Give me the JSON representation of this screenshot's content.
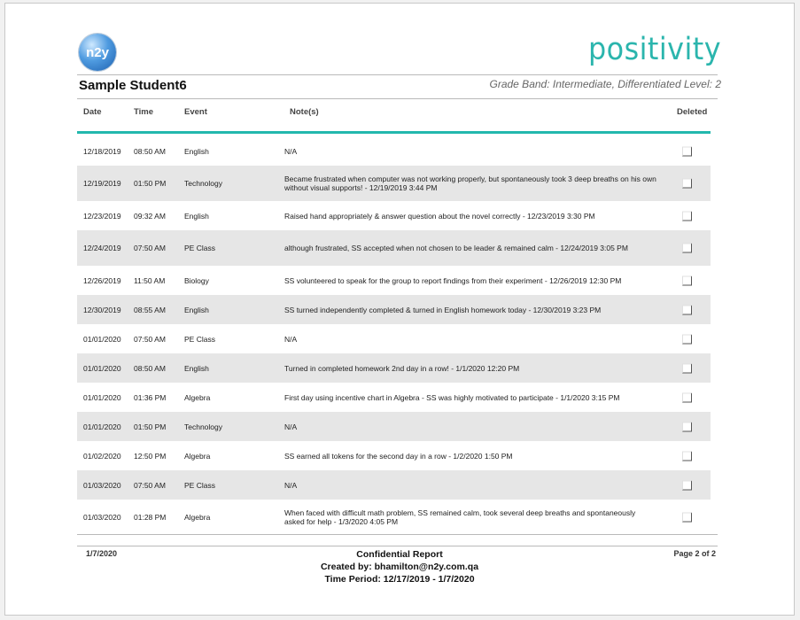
{
  "header": {
    "logo_text": "n2y",
    "brand": "positivity",
    "student_name": "Sample Student6",
    "grade_band": "Grade Band: Intermediate, Differentiated Level: 2"
  },
  "table": {
    "columns": [
      "Date",
      "Time",
      "Event",
      "Note(s)",
      "Deleted"
    ],
    "rows": [
      {
        "date": "12/18/2019",
        "time": "08:50 AM",
        "event": "English",
        "note": "N/A",
        "deleted": false
      },
      {
        "date": "12/19/2019",
        "time": "01:50 PM",
        "event": "Technology",
        "note": "Became frustrated when computer was not working properly, but spontaneously took 3 deep breaths on his own without visual supports! - 12/19/2019 3:44 PM",
        "deleted": false
      },
      {
        "date": "12/23/2019",
        "time": "09:32 AM",
        "event": "English",
        "note": "Raised hand appropriately & answer question about the novel correctly - 12/23/2019 3:30 PM",
        "deleted": false
      },
      {
        "date": "12/24/2019",
        "time": "07:50 AM",
        "event": "PE Class",
        "note": "although frustrated, SS accepted when not chosen to be leader & remained calm - 12/24/2019 3:05 PM",
        "deleted": false
      },
      {
        "date": "12/26/2019",
        "time": "11:50 AM",
        "event": "Biology",
        "note": "SS volunteered to speak for the group to report findings from their experiment - 12/26/2019 12:30 PM",
        "deleted": false
      },
      {
        "date": "12/30/2019",
        "time": "08:55 AM",
        "event": "English",
        "note": "SS turned independently completed & turned in English homework today - 12/30/2019 3:23 PM",
        "deleted": false
      },
      {
        "date": "01/01/2020",
        "time": "07:50 AM",
        "event": "PE Class",
        "note": "N/A",
        "deleted": false
      },
      {
        "date": "01/01/2020",
        "time": "08:50 AM",
        "event": "English",
        "note": "Turned in completed homework 2nd day in a row! - 1/1/2020 12:20 PM",
        "deleted": false
      },
      {
        "date": "01/01/2020",
        "time": "01:36 PM",
        "event": "Algebra",
        "note": "First day using incentive chart in Algebra - SS was highly motivated to participate - 1/1/2020 3:15 PM",
        "deleted": false
      },
      {
        "date": "01/01/2020",
        "time": "01:50 PM",
        "event": "Technology",
        "note": "N/A",
        "deleted": false
      },
      {
        "date": "01/02/2020",
        "time": "12:50 PM",
        "event": "Algebra",
        "note": "SS earned all tokens for the second day in a row - 1/2/2020 1:50 PM",
        "deleted": false
      },
      {
        "date": "01/03/2020",
        "time": "07:50 AM",
        "event": "PE Class",
        "note": "N/A",
        "deleted": false
      },
      {
        "date": "01/03/2020",
        "time": "01:28 PM",
        "event": "Algebra",
        "note": "When faced with difficult math problem, SS remained calm, took several deep breaths and spontaneously asked for help - 1/3/2020 4:05 PM",
        "deleted": false
      }
    ]
  },
  "footer": {
    "date": "1/7/2020",
    "title": "Confidential Report",
    "created_by": "Created by: bhamilton@n2y.com.qa",
    "time_period": "Time Period: 12/17/2019 - 1/7/2020",
    "page": "Page 2 of 2"
  },
  "colors": {
    "accent": "#22b8ad",
    "brand": "#2bb5ad",
    "heart": "#e4708f",
    "row_shade": "#e6e6e6"
  }
}
